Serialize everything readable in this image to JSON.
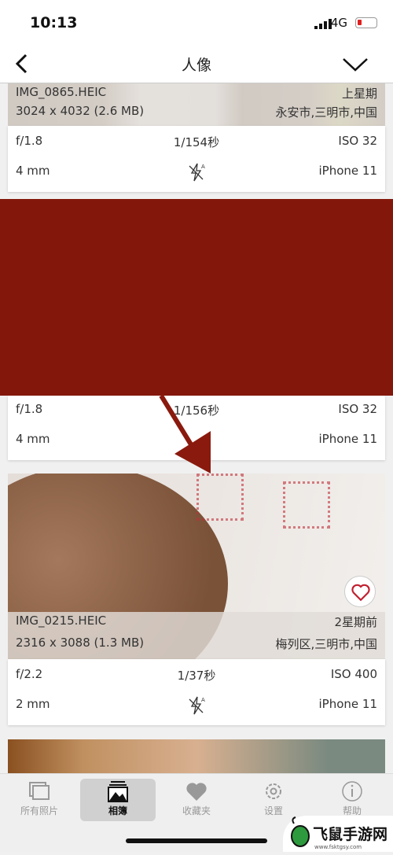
{
  "status": {
    "time": "10:13",
    "network": "4G"
  },
  "nav": {
    "title": "人像",
    "back_icon": "chevron-left-icon",
    "menu_icon": "chevron-down-icon"
  },
  "photos": [
    {
      "name": "IMG_0865.HEIC",
      "date": "上星期",
      "size": "3024 x 4032 (2.6 MB)",
      "location": "永安市,三明市,中国",
      "aperture": "f/1.8",
      "shutter": "1/154秒",
      "iso": "ISO 32",
      "focal": "4 mm",
      "device": "iPhone 11",
      "flash_icon": "flash-auto-off-icon"
    },
    {
      "aperture": "f/1.8",
      "shutter": "1/156秒",
      "iso": "ISO 32",
      "focal": "4 mm",
      "device": "iPhone 11"
    },
    {
      "name": "IMG_0215.HEIC",
      "date": "2星期前",
      "size": "2316 x 3088 (1.3 MB)",
      "location": "梅列区,三明市,中国",
      "aperture": "f/2.2",
      "shutter": "1/37秒",
      "iso": "ISO 400",
      "focal": "2 mm",
      "device": "iPhone 11",
      "favorite": true
    }
  ],
  "colors": {
    "redact": "#84170b",
    "arrow": "#8a1a0e"
  },
  "tabs": [
    {
      "label": "所有照片",
      "icon": "photos-icon"
    },
    {
      "label": "相簿",
      "icon": "album-icon",
      "active": true
    },
    {
      "label": "收藏夹",
      "icon": "heart-icon"
    },
    {
      "label": "设置",
      "icon": "gear-icon"
    },
    {
      "label": "帮助",
      "icon": "info-icon"
    }
  ],
  "watermark": {
    "text": "飞鼠手游网",
    "url_text": "www.fsktgsy.com"
  }
}
